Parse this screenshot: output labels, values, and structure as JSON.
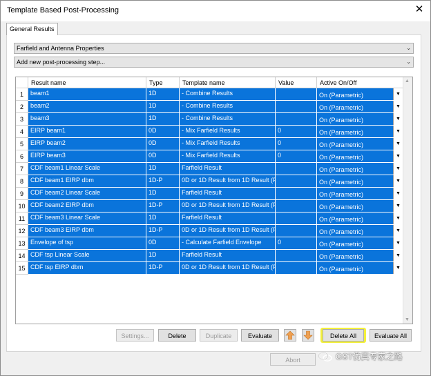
{
  "window": {
    "title": "Template Based Post-Processing"
  },
  "tab": {
    "label": "General Results"
  },
  "combos": {
    "category": "Farfield and Antenna Properties",
    "add_step": "Add new post-processing step..."
  },
  "columns": [
    "Result name",
    "Type",
    "Template name",
    "Value",
    "Active On/Off"
  ],
  "rows": [
    {
      "n": "1",
      "name": "beam1",
      "type": "1D",
      "template": "- Combine Results",
      "value": "",
      "active": "On (Parametric)"
    },
    {
      "n": "2",
      "name": "beam2",
      "type": "1D",
      "template": "- Combine Results",
      "value": "",
      "active": "On (Parametric)"
    },
    {
      "n": "3",
      "name": "beam3",
      "type": "1D",
      "template": "- Combine Results",
      "value": "",
      "active": "On (Parametric)"
    },
    {
      "n": "4",
      "name": "EIRP beam1",
      "type": "0D",
      "template": "- Mix Farfield Results",
      "value": "0",
      "active": "On (Parametric)"
    },
    {
      "n": "5",
      "name": "EIRP beam2",
      "type": "0D",
      "template": "- Mix Farfield Results",
      "value": "0",
      "active": "On (Parametric)"
    },
    {
      "n": "6",
      "name": "EIRP beam3",
      "type": "0D",
      "template": "- Mix Farfield Results",
      "value": "0",
      "active": "On (Parametric)"
    },
    {
      "n": "7",
      "name": "CDF beam1 Linear Scale",
      "type": "1D",
      "template": "Farfield Result",
      "value": "",
      "active": "On (Parametric)"
    },
    {
      "n": "8",
      "name": "CDF beam1 EIRP dbm",
      "type": "1D-P",
      "template": "0D or 1D Result from 1D Result (F",
      "value": "",
      "active": "On (Parametric)"
    },
    {
      "n": "9",
      "name": "CDF beam2 Linear Scale",
      "type": "1D",
      "template": "Farfield Result",
      "value": "",
      "active": "On (Parametric)"
    },
    {
      "n": "10",
      "name": "CDF beam2 EIRP dbm",
      "type": "1D-P",
      "template": "0D or 1D Result from 1D Result (F",
      "value": "",
      "active": "On (Parametric)"
    },
    {
      "n": "11",
      "name": "CDF beam3 Linear Scale",
      "type": "1D",
      "template": "Farfield Result",
      "value": "",
      "active": "On (Parametric)"
    },
    {
      "n": "12",
      "name": "CDF beam3 EIRP dbm",
      "type": "1D-P",
      "template": "0D or 1D Result from 1D Result (F",
      "value": "",
      "active": "On (Parametric)"
    },
    {
      "n": "13",
      "name": "Envelope of tsp",
      "type": "0D",
      "template": "- Calculate Farfield Envelope",
      "value": "0",
      "active": "On (Parametric)"
    },
    {
      "n": "14",
      "name": "CDF tsp Linear Scale",
      "type": "1D",
      "template": "Farfield Result",
      "value": "",
      "active": "On (Parametric)"
    },
    {
      "n": "15",
      "name": "CDF tsp EIRP dbm",
      "type": "1D-P",
      "template": "0D or 1D Result from 1D Result (F",
      "value": "",
      "active": "On (Parametric)"
    }
  ],
  "buttons": {
    "settings": "Settings...",
    "delete": "Delete",
    "duplicate": "Duplicate",
    "evaluate": "Evaluate",
    "delete_all": "Delete All",
    "evaluate_all": "Evaluate All",
    "abort": "Abort"
  },
  "watermark": "GST仿真专家之路",
  "colors": {
    "selection": "#0a74db",
    "highlight": "#f3f03a",
    "arrow": "#f0a050"
  },
  "icons": {
    "move_up": "arrow-up-icon",
    "move_down": "arrow-down-icon",
    "close": "close-icon",
    "dropdown": "chevron-down-icon"
  }
}
